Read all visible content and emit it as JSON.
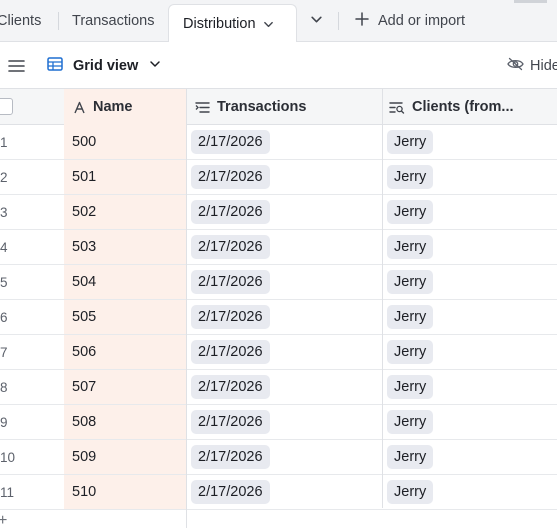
{
  "tabs": {
    "clients": "Clients",
    "transactions": "Transactions",
    "distribution": "Distribution",
    "add": "Add or import"
  },
  "toolbar": {
    "view_name": "Grid view",
    "hide_label": "Hide"
  },
  "columns": {
    "name": "Name",
    "transactions": "Transactions",
    "clients": "Clients (from..."
  },
  "rows": [
    {
      "num": "1",
      "name": "500",
      "transaction": "2/17/2026",
      "client": "Jerry"
    },
    {
      "num": "2",
      "name": "501",
      "transaction": "2/17/2026",
      "client": "Jerry"
    },
    {
      "num": "3",
      "name": "502",
      "transaction": "2/17/2026",
      "client": "Jerry"
    },
    {
      "num": "4",
      "name": "503",
      "transaction": "2/17/2026",
      "client": "Jerry"
    },
    {
      "num": "5",
      "name": "504",
      "transaction": "2/17/2026",
      "client": "Jerry"
    },
    {
      "num": "6",
      "name": "505",
      "transaction": "2/17/2026",
      "client": "Jerry"
    },
    {
      "num": "7",
      "name": "506",
      "transaction": "2/17/2026",
      "client": "Jerry"
    },
    {
      "num": "8",
      "name": "507",
      "transaction": "2/17/2026",
      "client": "Jerry"
    },
    {
      "num": "9",
      "name": "508",
      "transaction": "2/17/2026",
      "client": "Jerry"
    },
    {
      "num": "10",
      "name": "509",
      "transaction": "2/17/2026",
      "client": "Jerry"
    },
    {
      "num": "11",
      "name": "510",
      "transaction": "2/17/2026",
      "client": "Jerry"
    }
  ],
  "icons": {
    "view": "grid-view-icon",
    "menu": "hamburger-menu-icon",
    "hide": "eye-slash-icon",
    "name_field": "text-field-icon",
    "transactions_field": "linked-record-icon",
    "clients_field": "lookup-field-icon"
  },
  "colors": {
    "primary_field_bg": "#fdf0ea",
    "pill_bg": "#e8eaf0",
    "grid_icon_blue": "#1f6fd1"
  }
}
